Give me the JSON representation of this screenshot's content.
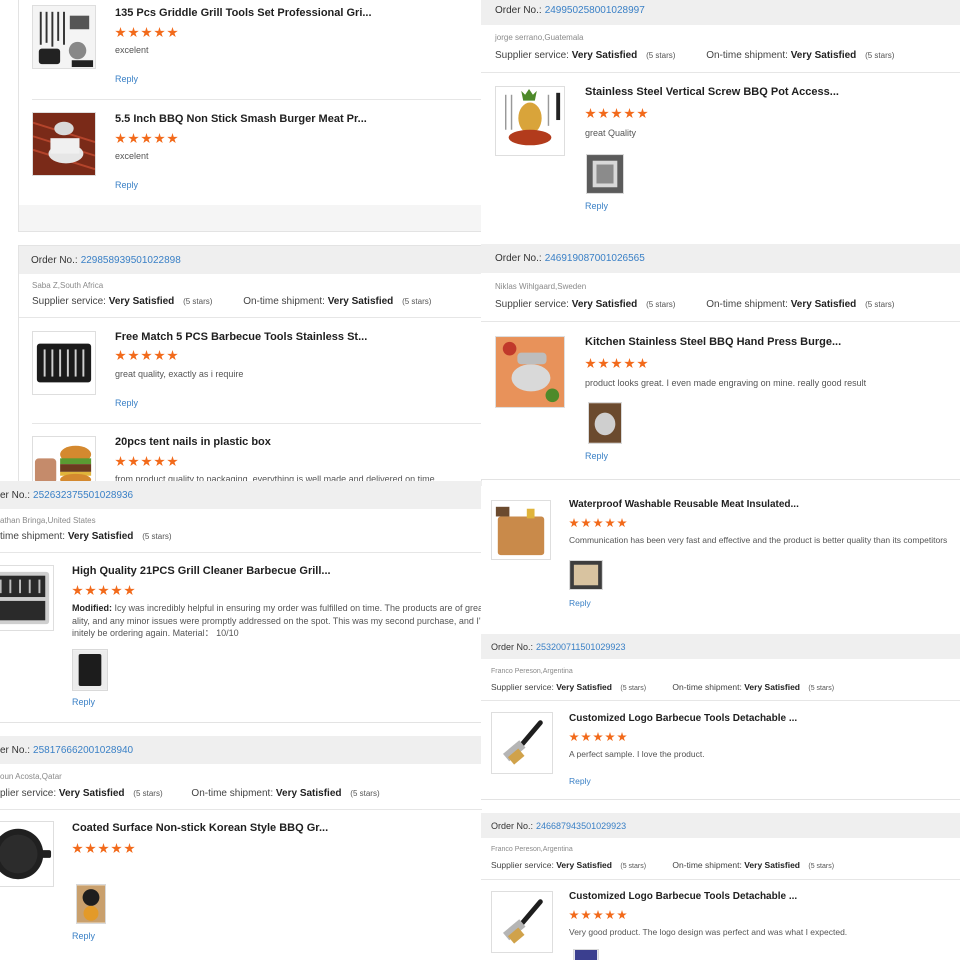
{
  "labels": {
    "order_no": "Order No.:",
    "supplier_service": "Supplier service:",
    "ontime_shipment": "On-time shipment:",
    "reply": "Reply",
    "order_no_cut": "er No.:",
    "supplier_service_cut": "plier service:",
    "ontime_shipment_cut": "time shipment:",
    "modified_label": "Modified:"
  },
  "rating": {
    "value": "Very Satisfied",
    "stars_note": "(5 stars)",
    "score": 5,
    "max": 5
  },
  "colors": {
    "star": "#f26a1b",
    "link": "#3a80c6",
    "order_bar": "#efefef"
  },
  "panel_a": {
    "products": [
      {
        "title": "135 Pcs Griddle Grill Tools Set Professional Gri...",
        "comment": "excelent"
      },
      {
        "title": "5.5 Inch BBQ Non Stick Smash Burger Meat Pr...",
        "comment": "excelent"
      }
    ]
  },
  "panel_b": {
    "order_number": "229858939501022898",
    "buyer": "Saba Z,South Africa",
    "products": [
      {
        "title": "Free Match 5 PCS Barbecue Tools Stainless St...",
        "comment": "great quality, exactly as i require"
      },
      {
        "title": "20pcs tent nails in plastic box",
        "comment": "from product quality to packaging, everything is well made and delivered on time"
      }
    ]
  },
  "panel_c": {
    "order_number": "252632375501028936",
    "buyer": "athan Bringa,United States",
    "product": {
      "title": "High Quality 21PCS Grill Cleaner Barbecue Grill...",
      "comment_lines": [
        "Icy was incredibly helpful in ensuring my order was fulfilled on time. The products are of grea",
        "ality, and any minor issues were promptly addressed on the spot. This was my second purchase, and I'",
        "initely be ordering again. Material：  10/10"
      ]
    }
  },
  "panel_d": {
    "order_number": "258176662001028940",
    "buyer": "oun Acosta,Qatar",
    "product": {
      "title": "Coated Surface Non-stick Korean Style BBQ Gr..."
    }
  },
  "panel_e": {
    "order_number": "249950258001028997",
    "buyer": "jorge serrano,Guatemala",
    "product": {
      "title": "Stainless Steel Vertical Screw BBQ Pot Access...",
      "comment": "great Quality"
    }
  },
  "panel_f": {
    "order_number": "246919087001026565",
    "buyer": "Niklas Wihlgaard,Sweden",
    "product": {
      "title": "Kitchen Stainless Steel BBQ Hand Press Burge...",
      "comment": "product looks great. I even made engraving on mine. really good result"
    }
  },
  "panel_g": {
    "product": {
      "title": "Waterproof Washable Reusable Meat Insulated...",
      "comment": "Communication has been very fast and effective and the product is better quality than its competitors"
    }
  },
  "panel_h": {
    "order_number": "253200711501029923",
    "buyer": "Franco Pereson,Argentina",
    "product": {
      "title": "Customized Logo Barbecue Tools Detachable ...",
      "comment": "A perfect sample. I love the product."
    }
  },
  "panel_i": {
    "order_number": "246687943501029923",
    "buyer": "Franco Pereson,Argentina",
    "product": {
      "title": "Customized Logo Barbecue Tools Detachable ...",
      "comment": "Very good product. The logo design was perfect and was what I expected."
    }
  }
}
